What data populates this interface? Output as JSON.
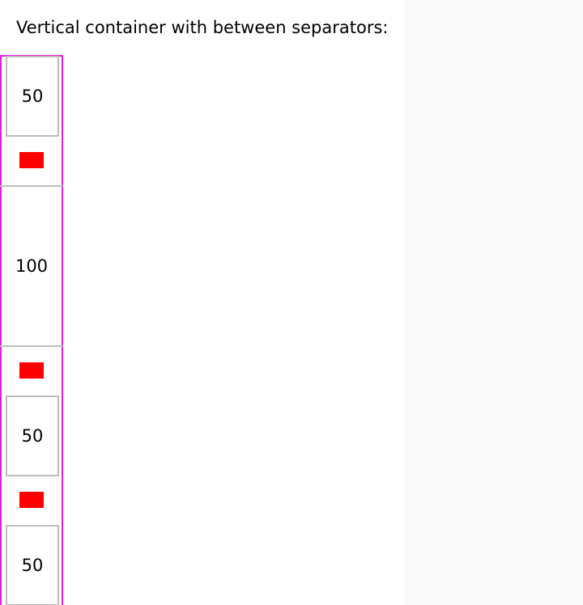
{
  "page": {
    "title": "Vertical container with between separators:"
  },
  "items": [
    {
      "label": "50"
    },
    {
      "label": "100"
    },
    {
      "label": "50"
    },
    {
      "label": "50"
    }
  ],
  "colors": {
    "container_border": "#e31be3",
    "item_border": "#bdbdbd",
    "separator": "#ff0000",
    "right_panel": "#f9f9f9"
  }
}
